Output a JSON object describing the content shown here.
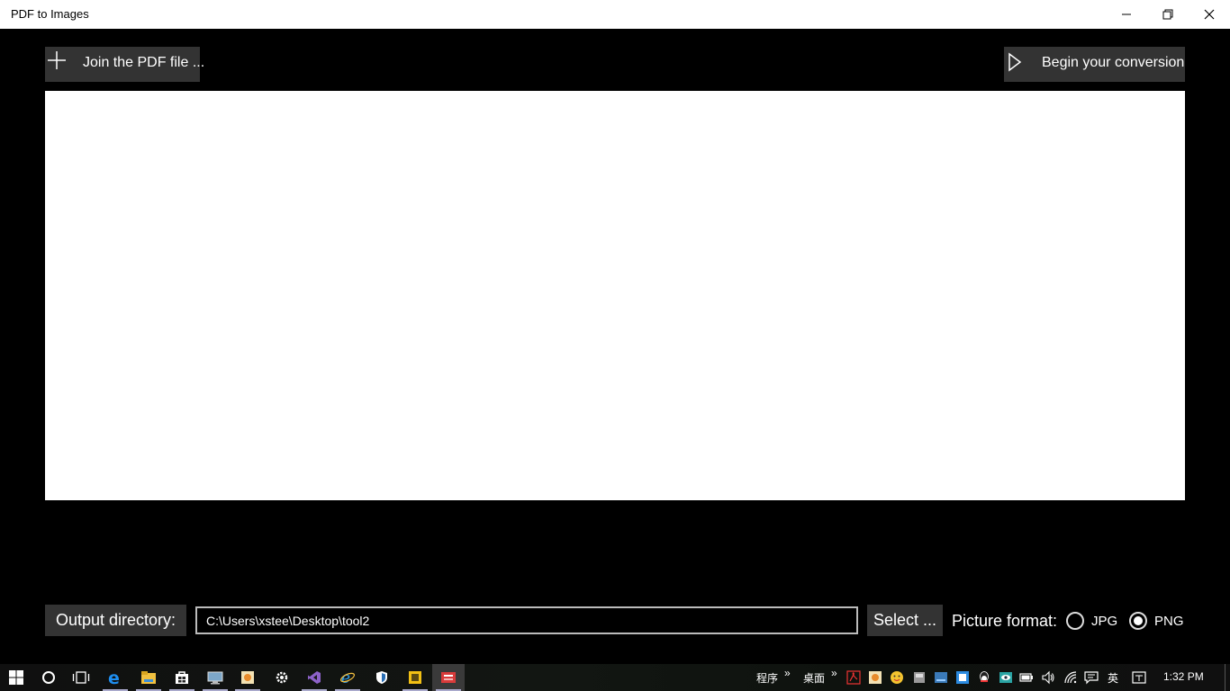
{
  "window": {
    "title": "PDF to Images"
  },
  "toolbar": {
    "join_label": "Join the PDF file ...",
    "begin_label": "Begin your conversion"
  },
  "output": {
    "label": "Output directory:",
    "path": "C:\\Users\\xstee\\Desktop\\tool2",
    "select_label": "Select ..."
  },
  "format": {
    "label": "Picture format:",
    "options": [
      {
        "label": "JPG",
        "checked": false
      },
      {
        "label": "PNG",
        "checked": true
      }
    ]
  },
  "taskbar": {
    "apps": [
      "windows-start-icon",
      "cortana-icon",
      "task-view-icon",
      "edge-icon",
      "file-explorer-icon",
      "store-icon",
      "remote-desktop-icon",
      "paint-icon",
      "settings-icon",
      "visual-studio-icon",
      "internet-explorer-icon",
      "defender-icon",
      "sticky-app-icon",
      "pdf-to-images-app-icon"
    ],
    "tray_labels": [
      "程序",
      "»",
      "桌面",
      "»",
      "英"
    ],
    "clock": "1:32 PM"
  }
}
